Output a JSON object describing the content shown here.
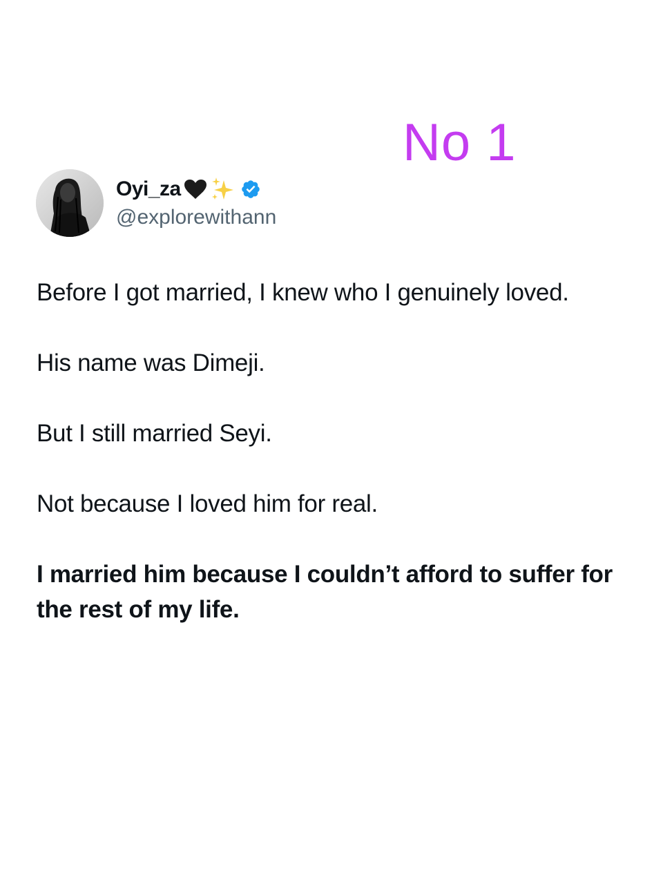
{
  "overlay": {
    "label": "No 1",
    "color": "#c43cf0"
  },
  "tweet": {
    "author": {
      "display_name": "Oyi_za",
      "handle": "@explorewithann",
      "verified": true,
      "emoji_icons": [
        "black-heart-icon",
        "sparkles-icon"
      ],
      "verified_color": "#1d9bf0"
    },
    "paragraphs": [
      {
        "text": "Before I got married, I knew who I genuinely loved.",
        "bold": false
      },
      {
        "text": "His name was Dimeji.",
        "bold": false
      },
      {
        "text": "But I still married Seyi.",
        "bold": false
      },
      {
        "text": "Not because I loved him for real.",
        "bold": false
      },
      {
        "text": "I married him because I couldn’t afford to suffer for the rest of my life.",
        "bold": true
      }
    ]
  }
}
